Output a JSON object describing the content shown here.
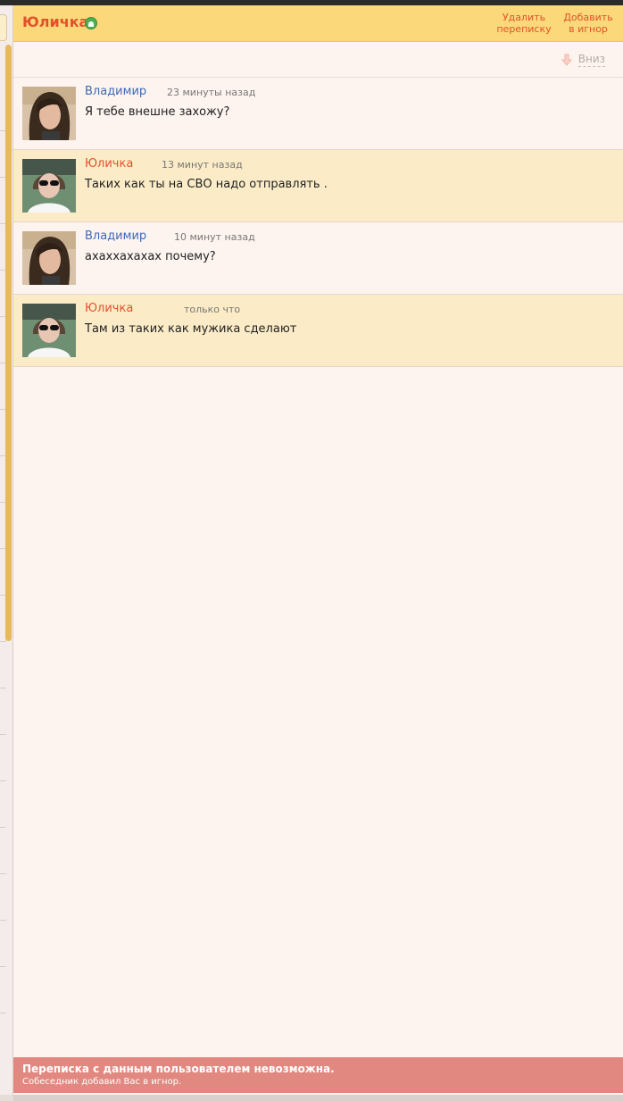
{
  "header": {
    "name": "Юличка",
    "delete_label": "Удалить\nпереписку",
    "ignore_label": "Добавить\nв игнор",
    "accent_color": "#e0522a",
    "header_bg": "#fbd97a"
  },
  "toolbar": {
    "down_label": "Вниз"
  },
  "messages": [
    {
      "author": "Владимир",
      "time": "23 минуты назад",
      "text": "Я тебе внешне захожу?"
    },
    {
      "author": "Юличка",
      "time": "13 минут назад",
      "text": "Таких как ты на СВО надо отправлять ."
    },
    {
      "author": "Владимир",
      "time": "10 минут назад",
      "text": "ахаххахахах почему?"
    },
    {
      "author": "Юличка",
      "time": "только что",
      "text": "Там из таких как мужика сделают"
    }
  ],
  "footer": {
    "title": "Переписка с данным пользователем невозможна.",
    "subtitle": "Собеседник добавил Вас в игнор.",
    "bg_color": "#e18880"
  }
}
